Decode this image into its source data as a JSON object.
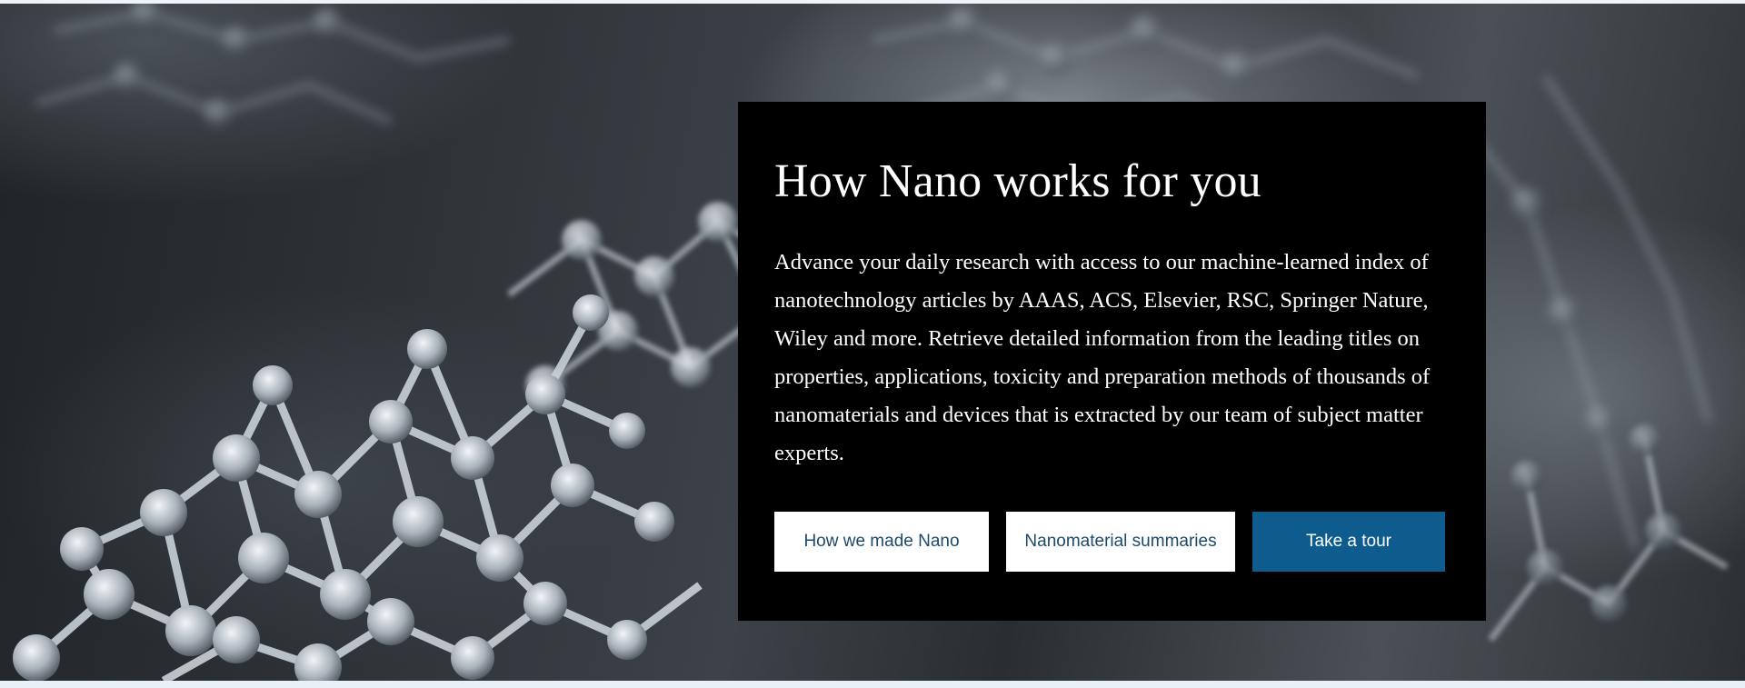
{
  "hero": {
    "title": "How Nano works for you",
    "description": "Advance your daily research with access to our machine-learned index of nanotechnology articles by AAAS, ACS, Elsevier, RSC, Springer Nature, Wiley and more. Retrieve detailed information from the leading titles on properties, applications, toxicity and preparation methods of thousands of nanomaterials and devices that is extracted by our team of subject matter experts.",
    "buttons": {
      "how_made": "How we made Nano",
      "summaries": "Nanomaterial summaries",
      "tour": "Take a tour"
    }
  },
  "colors": {
    "panel_background": "#000000",
    "primary_button": "#0d5c8d",
    "outline_button_text": "#1b4a6b"
  },
  "background_image": "molecular-lattice-image"
}
